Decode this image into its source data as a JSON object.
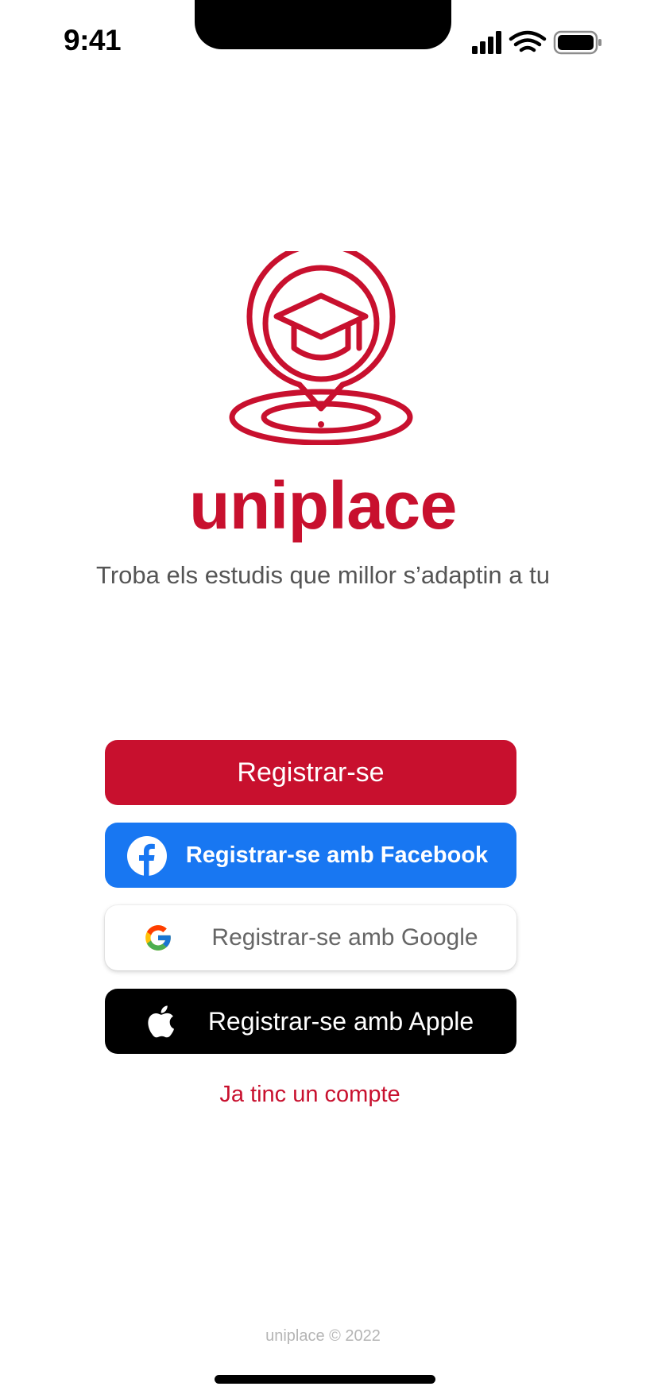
{
  "status_bar": {
    "time": "9:41",
    "icons": [
      "cellular-signal-icon",
      "wifi-icon",
      "battery-icon"
    ]
  },
  "brand": {
    "name": "uniplace",
    "tagline": "Troba els estudis que millor s’adaptin a tu",
    "logo_icon": "graduation-cap-location-pin-icon",
    "accent_color": "#C8102E"
  },
  "actions": {
    "register_label": "Registrar-se",
    "facebook_label": "Registrar-se amb Facebook",
    "google_label": "Registrar-se amb Google",
    "apple_label": "Registrar-se amb Apple",
    "login_link": "Ja tinc un compte"
  },
  "colors": {
    "facebook": "#1877F2",
    "apple": "#000000",
    "google_bg": "#FFFFFF"
  },
  "footer": {
    "text": "uniplace © 2022"
  }
}
